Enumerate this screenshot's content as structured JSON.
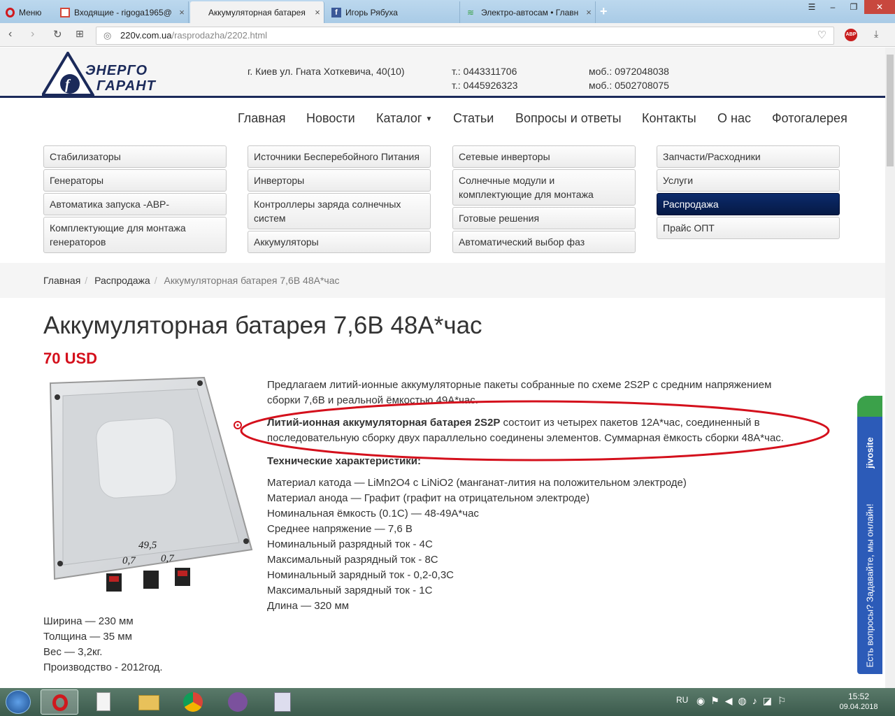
{
  "browser": {
    "menu_label": "Меню",
    "tabs": [
      {
        "label": "Входящие - rigoga1965@"
      },
      {
        "label": "Аккумуляторная батарея"
      },
      {
        "label": "Игорь Рябуха"
      },
      {
        "label": "Электро-автосам • Главн"
      }
    ],
    "url_domain": "220v.com.ua",
    "url_path": "/rasprodazha/2202.html",
    "abp_label": "ABP"
  },
  "header": {
    "logo_line1": "ЭНЕРГО",
    "logo_line2": "ГАРАНТ",
    "address": "г. Киев ул. Гната Хоткевича, 40(10)",
    "phone1": "т.: 0443311706",
    "phone2": "т.: 0445926323",
    "mob1": "моб.: 0972048038",
    "mob2": "моб.: 0502708075"
  },
  "nav": [
    "Главная",
    "Новости",
    "Каталог",
    "Статьи",
    "Вопросы и ответы",
    "Контакты",
    "О нас",
    "Фотогалерея"
  ],
  "catalog": {
    "col1": [
      "Стабилизаторы",
      "Генераторы",
      "Автоматика запуска -АВР-",
      "Комплектующие для монтажа генераторов"
    ],
    "col2": [
      "Источники Бесперебойного Питания",
      "Инверторы",
      "Контроллеры заряда солнечных систем",
      "Аккумуляторы"
    ],
    "col3": [
      "Сетевые инверторы",
      "Солнечные модули и комплектующие для монтажа",
      "Готовые решения",
      "Автоматический выбор фаз"
    ],
    "col4": [
      "Запчасти/Расходники",
      "Услуги",
      "Распродажа",
      "Прайс ОПТ"
    ]
  },
  "breadcrumb": {
    "home": "Главная",
    "section": "Распродажа",
    "current": "Аккумуляторная батарея 7,6В 48А*час"
  },
  "product": {
    "title": "Аккумуляторная батарея 7,6В 48А*час",
    "price": "70 USD",
    "intro_line1": "Предлагаем литий-ионные аккумуляторные пакеты собранные по схеме 2S2P с средним напряжением",
    "intro_line2": "сборки 7,6В и реальной ёмкостью 49А*час.",
    "highlight_bold": "Литий-ионная аккумуляторная батарея 2S2P",
    "highlight_rest": " состоит из четырех пакетов 12А*час, соединенный в",
    "highlight_line2": "последовательную сборку двух параллельно соединены элементов. Суммарная ёмкость сборки 48А*час.",
    "specs_title": "Технические характеристики:",
    "specs": [
      "Материал катода — LiMn2O4 с LiNiO2 (манганат-лития на положительном электроде)",
      "Материал анода — Графит (графит на отрицательном электроде)",
      "Номинальная ёмкость (0.1C) — 48-49А*час",
      "Среднее напряжение — 7,6 В",
      "Номинальный разрядный ток - 4C",
      "Максимальный разрядный ток - 8C",
      "Номинальный зарядный ток - 0,2-0,3C",
      "Максимальный зарядный ток - 1C",
      "Длина — 320 мм"
    ],
    "dims": [
      "Ширина — 230 мм",
      "Толщина — 35 мм",
      "Вес — 3,2кг.",
      "Производство - 2012год."
    ],
    "photo_marks": [
      "49,5",
      "0,7",
      "0,7"
    ]
  },
  "widget": {
    "brand": "jivosite",
    "text": "Есть вопросы? Задавайте, мы онлайн!"
  },
  "taskbar": {
    "lang": "RU",
    "time": "15:52",
    "date": "09.04.2018"
  },
  "colors": {
    "accent_red": "#d4101c",
    "nav_dark": "#0b2a6b",
    "widget_blue": "#2c5bb8",
    "widget_green": "#3ba14a"
  }
}
